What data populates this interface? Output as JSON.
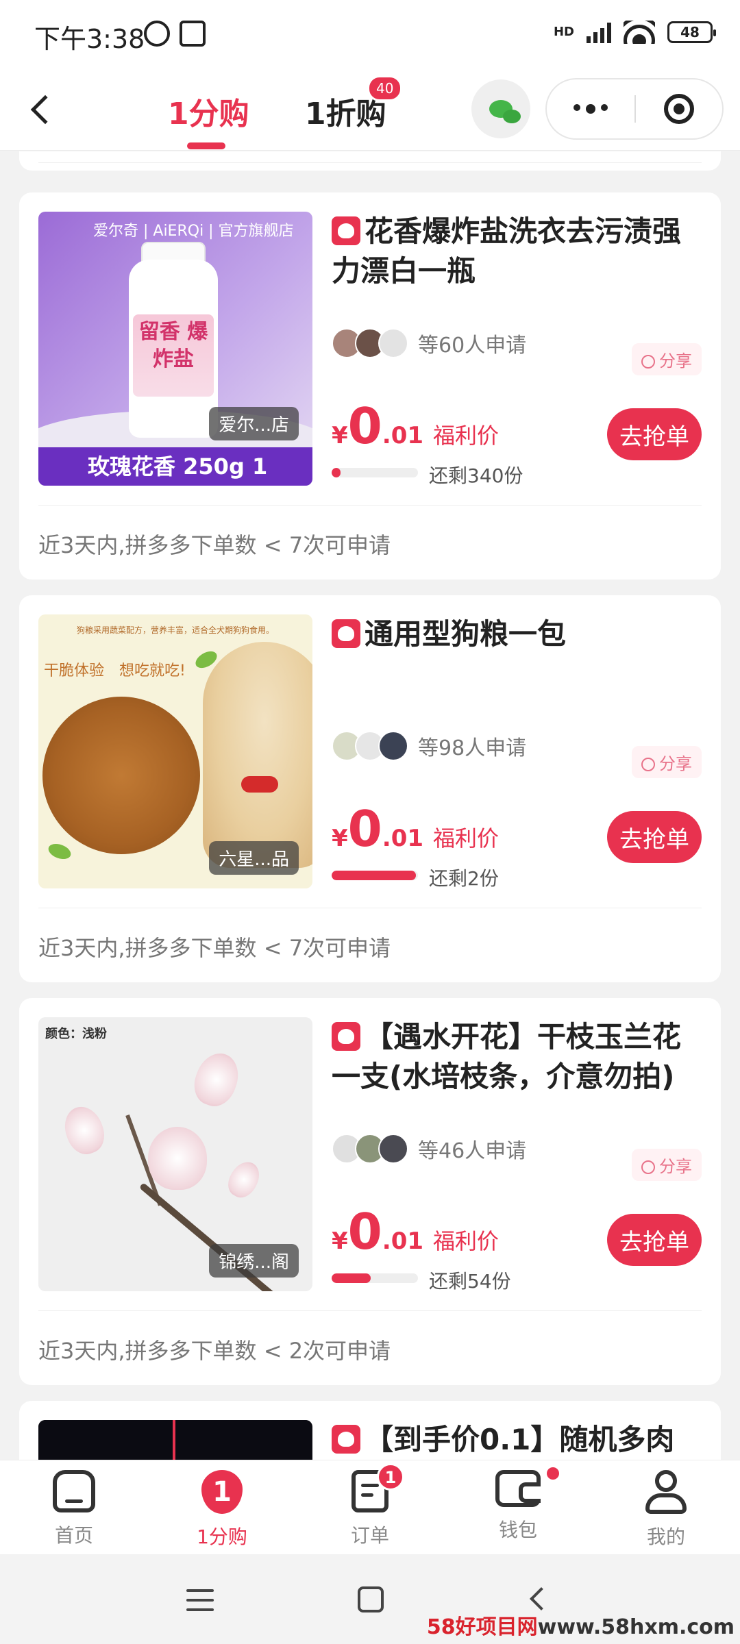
{
  "status_bar": {
    "time": "下午3:38",
    "network": "HD",
    "battery": "48"
  },
  "nav": {
    "tabs": [
      {
        "label": "1分购",
        "active": true
      },
      {
        "label": "1折购",
        "active": false,
        "badge": "40"
      }
    ],
    "icons": [
      "back-arrow-icon",
      "wechat-icon",
      "more-icon",
      "close-mini-program-icon"
    ]
  },
  "products": [
    {
      "title": "花香爆炸盐洗衣去污渍强力漂白一瓶",
      "image_text": {
        "brand": "爱尔奇 | AiERQi | 官方旗舰店",
        "label": "留香 爆炸盐",
        "band": "玫瑰花香 250g 1"
      },
      "shop": "爱尔...店",
      "applicants": "等60人申请",
      "share": "分享",
      "price_yen": "¥",
      "price_int": "0",
      "price_dec": ".01",
      "price_label": "福利价",
      "progress": 0.1,
      "remaining": "还剩340份",
      "button": "去抢单",
      "condition": "近3天内,拼多多下单数 < 7次可申请"
    },
    {
      "title": "通用型狗粮一包",
      "image_text": {
        "top": "狗粮采用蔬菜配方，营养丰富，适合全犬期狗狗食用。",
        "slogan": "干脆体验　想吃就吃!"
      },
      "shop": "六星...品",
      "applicants": "等98人申请",
      "share": "分享",
      "price_yen": "¥",
      "price_int": "0",
      "price_dec": ".01",
      "price_label": "福利价",
      "progress": 0.98,
      "remaining": "还剩2份",
      "button": "去抢单",
      "condition": "近3天内,拼多多下单数 < 7次可申请"
    },
    {
      "title": "【遇水开花】干枝玉兰花一支(水培枝条，介意勿拍)",
      "image_text": {
        "color": "颜色：浅粉"
      },
      "shop": "锦绣...阁",
      "applicants": "等46人申请",
      "share": "分享",
      "price_yen": "¥",
      "price_int": "0",
      "price_dec": ".01",
      "price_label": "福利价",
      "progress": 0.45,
      "remaining": "还剩54份",
      "button": "去抢单",
      "condition": "近3天内,拼多多下单数 < 2次可申请"
    },
    {
      "title": "【到手价0.1】随机多肉"
    }
  ],
  "tabbar": [
    {
      "label": "首页",
      "icon": "home-icon"
    },
    {
      "label": "1分购",
      "icon": "one-cent-icon",
      "icon_text": "1",
      "active": true
    },
    {
      "label": "订单",
      "icon": "order-icon",
      "badge": "1"
    },
    {
      "label": "钱包",
      "icon": "wallet-icon",
      "dot": true
    },
    {
      "label": "我的",
      "icon": "profile-icon"
    }
  ],
  "watermark": {
    "part1": "58好项目网",
    "part2": "www.58hxm.com"
  },
  "colors": {
    "accent": "#e8324f",
    "background": "#f2f2f2"
  }
}
